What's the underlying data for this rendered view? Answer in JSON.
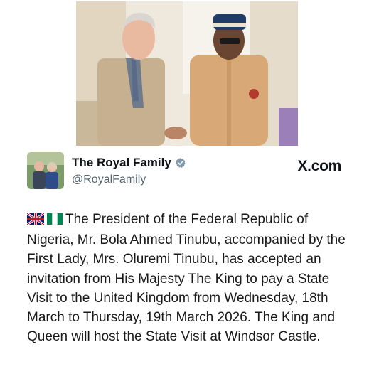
{
  "post": {
    "photo_alt": "The King shaking hands with President Tinubu",
    "account": {
      "display_name": "The Royal Family",
      "handle": "@RoyalFamily",
      "verified": true,
      "verified_badge_color": "#829aab"
    },
    "source_label": "X.com",
    "flags": [
      "uk-flag-icon",
      "nigeria-flag-icon"
    ],
    "text": "The President of the Federal Republic of Nigeria, Mr. Bola Ahmed Tinubu, accompanied by the First Lady, Mrs. Oluremi Tinubu, has accepted an invitation from His Majesty The King to pay a State Visit to the United Kingdom from Wednesday, 18th March to Thursday, 19th March 2026. The King and Queen will host the State Visit at Windsor Castle."
  }
}
